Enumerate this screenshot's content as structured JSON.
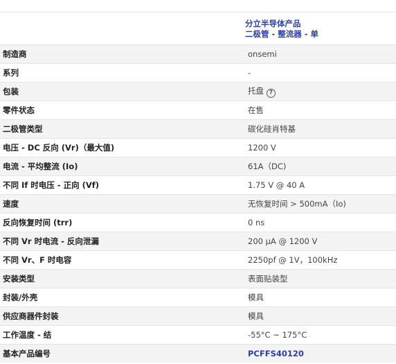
{
  "category": {
    "line1": "分立半导体产品",
    "line2": "二极管 - 整流器 - 单"
  },
  "rows": [
    {
      "label": "制造商",
      "value": "onsemi"
    },
    {
      "label": "系列",
      "value": "-"
    },
    {
      "label": "包装",
      "value": "托盘",
      "help": "?"
    },
    {
      "label": "零件状态",
      "value": "在售"
    },
    {
      "label": "二极管类型",
      "value": "碳化硅肖特基"
    },
    {
      "label": "电压 - DC 反向 (Vr)（最大值)",
      "value": "1200 V"
    },
    {
      "label": "电流 - 平均整流 (Io)",
      "value": "61A（DC)"
    },
    {
      "label": "不同 If 时电压 - 正向 (Vf)",
      "value": "1.75 V @ 40 A"
    },
    {
      "label": "速度",
      "value": "无恢复时间 > 500mA（Io)"
    },
    {
      "label": "反向恢复时间 (trr)",
      "value": "0 ns"
    },
    {
      "label": "不同 Vr 时电流 - 反向泄漏",
      "value": "200 µA @ 1200 V"
    },
    {
      "label": "不同 Vr、F 时电容",
      "value": "2250pf @ 1V，100kHz"
    },
    {
      "label": "安装类型",
      "value": "表面贴装型"
    },
    {
      "label": "封装/外壳",
      "value": "模具"
    },
    {
      "label": "供应商器件封装",
      "value": "模具"
    },
    {
      "label": "工作温度 - 结",
      "value": "-55°C ~ 175°C"
    },
    {
      "label": "基本产品编号",
      "value": "PCFFS40120"
    }
  ]
}
